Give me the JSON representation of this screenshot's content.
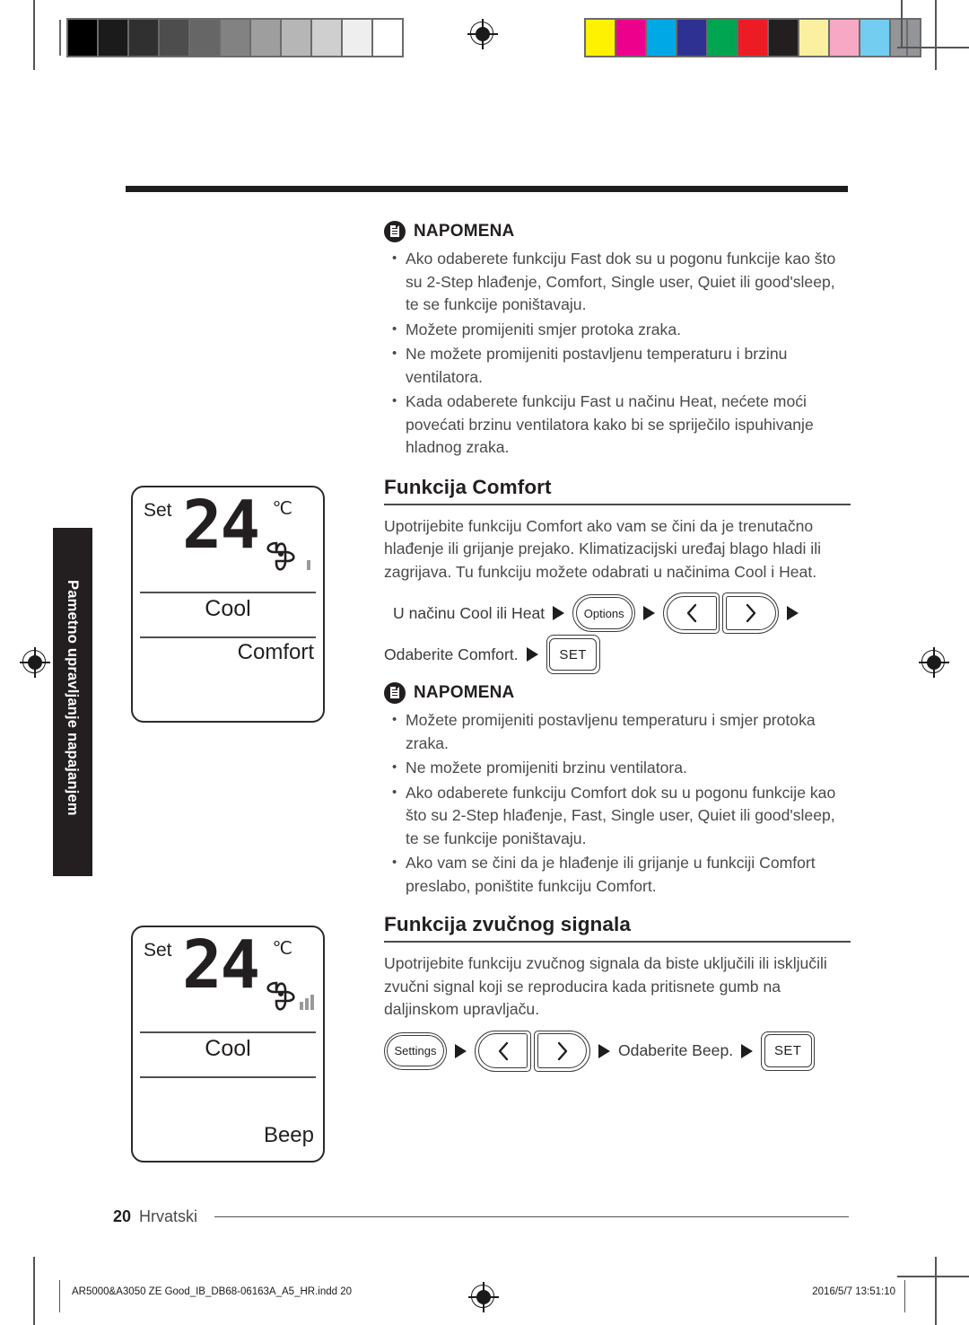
{
  "print_marks": {
    "gray_swatches": [
      "#000000",
      "#1b1b1b",
      "#303030",
      "#4d4d4d",
      "#666666",
      "#828282",
      "#9e9e9e",
      "#b6b6b6",
      "#cfcfcf",
      "#eeeeee",
      "#ffffff"
    ],
    "color_swatches": [
      "#fff200",
      "#ec008c",
      "#00a9e5",
      "#2e3192",
      "#00a551",
      "#ed1c24",
      "#231f20",
      "#faf0a0",
      "#f7a8c4",
      "#73cdf0",
      "#939598"
    ],
    "reg_mark": "registration-target-icon"
  },
  "side_tab": {
    "label": "Pametno upravljanje napajanjem"
  },
  "note_top": {
    "icon": "note-document-icon",
    "title": "NAPOMENA",
    "items": [
      "Ako odaberete funkciju Fast dok su u pogonu funkcije kao što su 2-Step hlađenje, Comfort, Single user, Quiet ili good'sleep, te se funkcije poništavaju.",
      "Možete promijeniti smjer protoka zraka.",
      "Ne možete promijeniti postavljenu temperaturu i brzinu ventilatora.",
      "Kada odaberete funkciju Fast u načinu Heat, nećete moći povećati brzinu ventilatora kako bi se spriječilo ispuhivanje hladnog zraka."
    ]
  },
  "section_comfort": {
    "heading": "Funkcija Comfort",
    "body": "Upotrijebite funkciju Comfort ako vam se čini da je trenutačno hlađenje ili grijanje prejako. Klimatizacijski uređaj blago hladi ili zagrijava. Tu funkciju možete odabrati u načinima Cool i Heat.",
    "step1_text": "U načinu Cool ili Heat",
    "step1_button": "Options",
    "step2_text": "Odaberite Comfort.",
    "step2_button": "SET"
  },
  "note_mid": {
    "icon": "note-document-icon",
    "title": "NAPOMENA",
    "items": [
      "Možete promijeniti postavljenu temperaturu i smjer protoka zraka.",
      "Ne možete promijeniti brzinu ventilatora.",
      "Ako odaberete funkciju Comfort dok su u pogonu funkcije kao što su 2-Step hlađenje, Fast, Single user, Quiet ili good'sleep, te se funkcije poništavaju.",
      "Ako vam se čini da je hlađenje ili grijanje u funkciji Comfort preslabo, poništite funkciju Comfort."
    ]
  },
  "section_beep": {
    "heading": "Funkcija zvučnog signala",
    "body": "Upotrijebite funkciju zvučnog signala da biste uključili ili isključili zvučni signal koji se reproducira kada pritisnete gumb na daljinskom upravljaču.",
    "step_button_settings": "Settings",
    "step_text": "Odaberite Beep.",
    "step_button_set": "SET"
  },
  "lcd_comfort": {
    "set_label": "Set",
    "temperature": "24",
    "unit": "℃",
    "mode": "Cool",
    "function_tag": "Comfort",
    "fan_icon": "fan-pinwheel-icon",
    "fan_bars": 1
  },
  "lcd_beep": {
    "set_label": "Set",
    "temperature": "24",
    "unit": "℃",
    "mode": "Cool",
    "function_tag": "Beep",
    "fan_icon": "fan-pinwheel-icon",
    "fan_bars": 3
  },
  "page_footer": {
    "page_number": "20",
    "language": "Hrvatski"
  },
  "print_footer": {
    "file": "AR5000&A3050 ZE Good_IB_DB68-06163A_A5_HR.indd   20",
    "timestamp": "2016/5/7   13:51:10"
  }
}
